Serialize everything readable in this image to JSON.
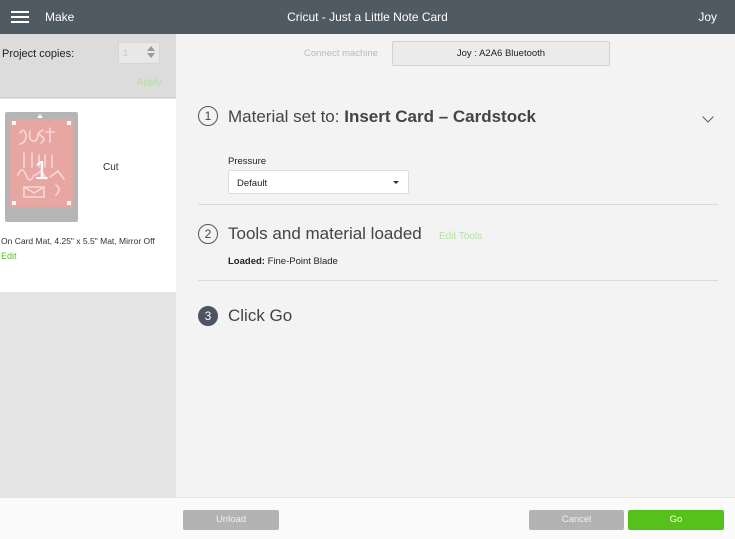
{
  "header": {
    "menu_label": "Make",
    "title": "Cricut - Just a Little Note Card",
    "user": "Joy"
  },
  "sidebar": {
    "project_copies_label": "Project copies:",
    "project_copies_value": "1",
    "apply_label": "Apply",
    "mat": {
      "number": "1",
      "operation": "Cut",
      "info": "On Card Mat, 4.25\" x 5.5\" Mat, Mirror Off",
      "edit_label": "Edit"
    }
  },
  "connect": {
    "label": "Connect machine",
    "machine": "Joy : A2A6 Bluetooth"
  },
  "steps": [
    {
      "number": "1",
      "prefix": "Material set to: ",
      "bold": "Insert Card – Cardstock"
    },
    {
      "number": "2",
      "title": "Tools and material loaded",
      "link": "Edit Tools"
    },
    {
      "number": "3",
      "title": "Click Go"
    }
  ],
  "pressure": {
    "label": "Pressure",
    "value": "Default"
  },
  "loaded": {
    "label": "Loaded:",
    "value": "Fine-Point Blade"
  },
  "footer": {
    "unload": "Unload",
    "cancel": "Cancel",
    "go": "Go"
  },
  "colors": {
    "topbar": "#505a63",
    "accent_green": "#56c11a",
    "mat_pink": "#e8a6a2"
  }
}
